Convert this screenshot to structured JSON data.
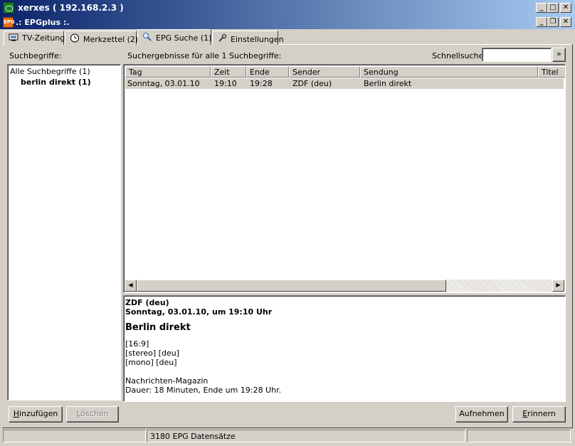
{
  "window": {
    "title": "xerxes ( 192.168.2.3 )",
    "app_title": ".: EPGplus :.",
    "app_icon_text": "EPG"
  },
  "tabs": [
    {
      "label": "TV-Zeitung",
      "icon": "tv-icon"
    },
    {
      "label": "Merkzettel (2)",
      "icon": "clock-icon"
    },
    {
      "label": "EPG Suche (1)",
      "icon": "search-icon"
    },
    {
      "label": "Einstellungen",
      "icon": "wrench-icon"
    }
  ],
  "left": {
    "label": "Suchbegriffe:",
    "tree": [
      {
        "label": "Alle Suchbegriffe (1)"
      },
      {
        "label": "berlin direkt (1)"
      }
    ],
    "add_button": "Hinzufügen",
    "delete_button": "Löschen"
  },
  "results": {
    "label": "Suchergebnisse für alle 1 Suchbegriffe:",
    "quicksearch_label": "Schnellsuche:",
    "quicksearch_value": "",
    "go_button": "»",
    "columns": [
      "Tag",
      "Zeit",
      "Ende",
      "Sender",
      "Sendung",
      "Titel"
    ],
    "rows": [
      [
        "Sonntag, 03.01.10",
        "19:10",
        "19:28",
        "ZDF (deu)",
        "Berlin direkt",
        ""
      ]
    ]
  },
  "detail": {
    "channel": "ZDF (deu)",
    "datetime": "Sonntag, 03.01.10, um 19:10 Uhr",
    "title": "Berlin direkt",
    "format": "[16:9]",
    "audio1": "[stereo] [deu]",
    "audio2": "[mono] [deu]",
    "genre": "Nachrichten-Magazin",
    "duration": "Dauer: 18 Minuten, Ende um 19:28 Uhr."
  },
  "actions": {
    "record_button": "Aufnehmen",
    "remind_button": "Erinnern"
  },
  "status": {
    "left": "",
    "center": "3180 EPG Datensätze",
    "right": ""
  }
}
